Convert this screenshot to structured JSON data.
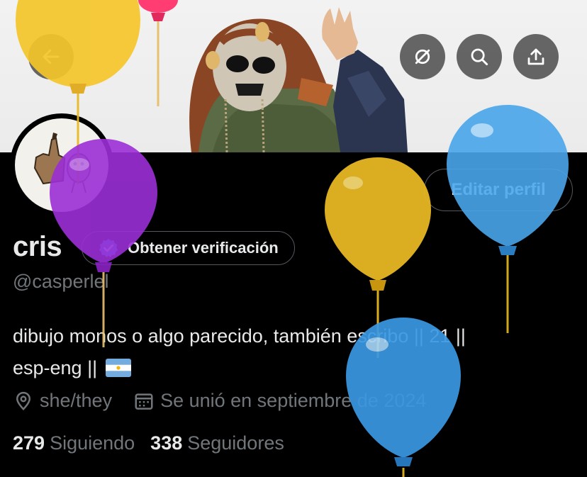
{
  "banner": {
    "back_icon": "arrow-left-icon",
    "mute_icon": "eye-slash-circle-icon",
    "search_icon": "search-icon",
    "share_icon": "share-upload-icon"
  },
  "profile": {
    "name": "cris",
    "handle": "@casperlel",
    "verify_label": "Obtener verificación",
    "edit_label": "Editar perfil",
    "bio_line1": "dibujo monos o algo parecido, también escribo || 21 ||",
    "bio_line2": "esp-eng ||",
    "flag": "argentina-flag",
    "pronouns": "she/they",
    "joined": "Se unió en septiembre de 2024",
    "following_count": "279",
    "following_label": "Siguiendo",
    "followers_count": "338",
    "followers_label": "Seguidores"
  },
  "colors": {
    "background": "#000000",
    "text_primary": "#e7e9ea",
    "text_secondary": "#71767b",
    "border": "#53585e",
    "verify_badge": "#1d9bf0",
    "balloon_yellow": "#f2c230",
    "balloon_purple": "#9b2fd6",
    "balloon_blue": "#4aa6ea",
    "balloon_pink": "#ff3d73"
  }
}
